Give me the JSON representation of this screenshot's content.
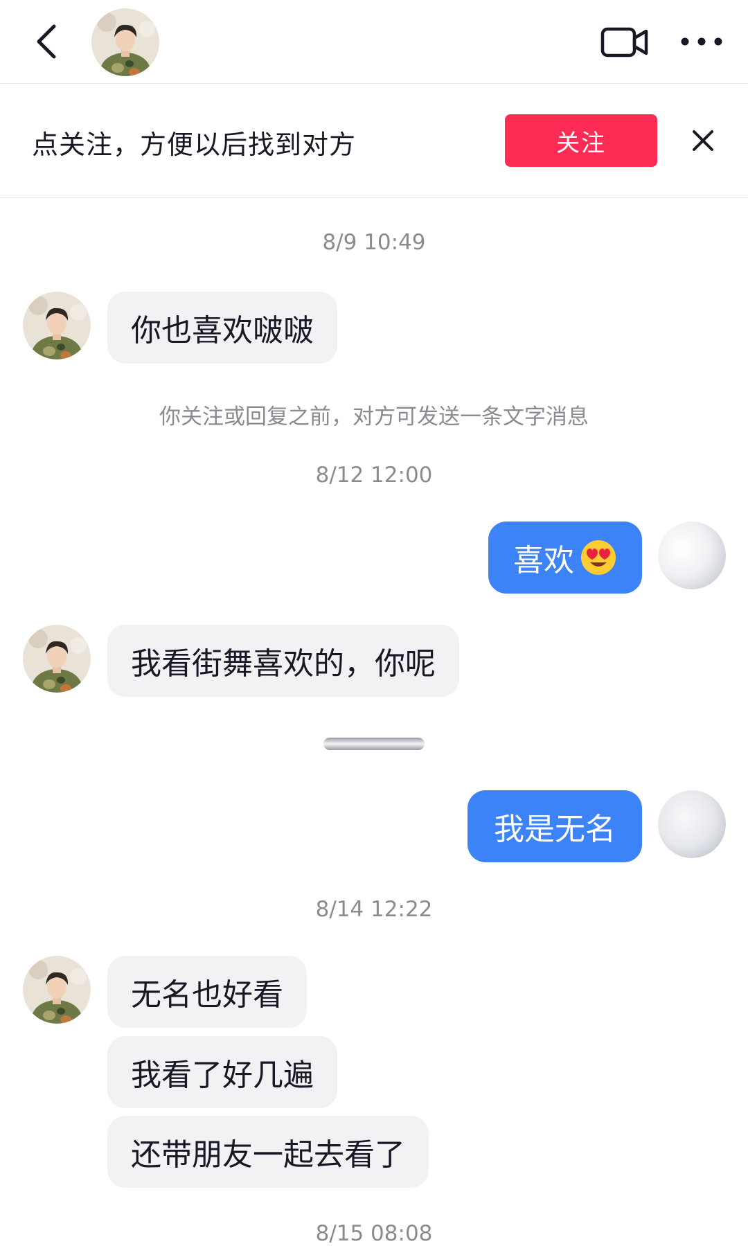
{
  "header": {
    "back_icon": "chevron-left-icon",
    "video_icon": "video-camera-icon",
    "more_icon": "ellipsis-icon"
  },
  "banner": {
    "text": "点关注，方便以后找到对方",
    "follow_label": "关注",
    "close_icon": "close-icon"
  },
  "colors": {
    "follow": "#fe2c55",
    "outgoing_bubble": "#3b83f6",
    "incoming_bubble": "#f2f2f4",
    "meta_text": "#8a8b91"
  },
  "chat": {
    "time_1": "8/9 10:49",
    "msg_1": "你也喜欢啵啵",
    "notice": "你关注或回复之前，对方可发送一条文字消息",
    "time_2": "8/12 12:00",
    "msg_2": "喜欢",
    "msg_2_emoji": "heart-eyes-emoji",
    "msg_3": "我看街舞喜欢的，你呢",
    "msg_4": "我是无名",
    "time_3": "8/14 12:22",
    "msg_5": "无名也好看",
    "msg_6": "我看了好几遍",
    "msg_7": "还带朋友一起去看了",
    "time_4": "8/15 08:08"
  }
}
